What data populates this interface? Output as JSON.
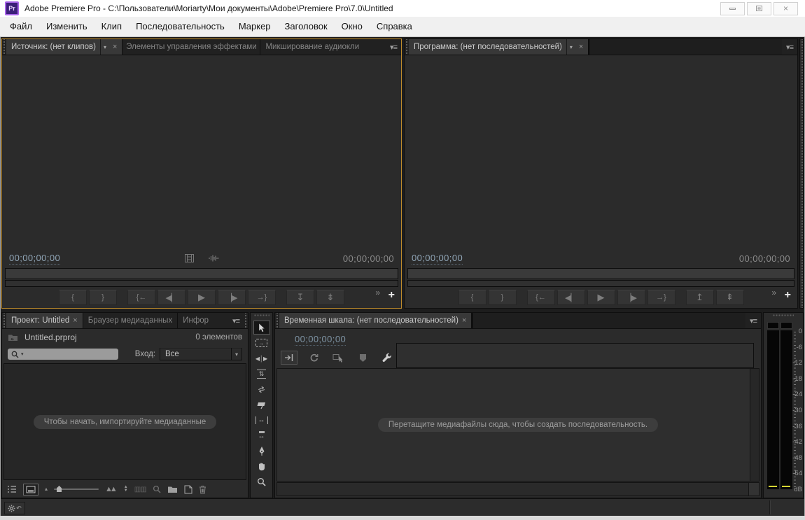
{
  "titlebar": {
    "app_icon_text": "Pr",
    "title": "Adobe Premiere Pro - C:\\Пользователи\\Moriarty\\Мои документы\\Adobe\\Premiere Pro\\7.0\\Untitled",
    "window_controls": {
      "close": "×"
    }
  },
  "menubar": {
    "items": [
      "Файл",
      "Изменить",
      "Клип",
      "Последовательность",
      "Маркер",
      "Заголовок",
      "Окно",
      "Справка"
    ]
  },
  "source_monitor": {
    "tab_source": "Источник: (нет клипов)",
    "tab_effects": "Элементы управления эффектами",
    "tab_audio_mixer": "Микширование аудиокли",
    "timecode_current": "00;00;00;00",
    "timecode_duration": "00;00;00;00"
  },
  "program_monitor": {
    "tab_program": "Программа: (нет последовательностей)",
    "timecode_current": "00;00;00;00",
    "timecode_duration": "00;00;00;00"
  },
  "transport": {
    "mark_in": "{",
    "mark_out": "}",
    "goto_in": "{←",
    "step_back": "◀▏",
    "play": "▶",
    "step_forward": "▕▶",
    "goto_out": "→}",
    "insert": "↧",
    "overwrite": "⇟",
    "lift": "↥",
    "extract": "⇞",
    "more": "»",
    "add_button": "+"
  },
  "project_panel": {
    "tab_project": "Проект: Untitled",
    "tab_media_browser": "Браузер медиаданных",
    "tab_info": "Инфор",
    "project_file": "Untitled.prproj",
    "item_count": "0 элементов",
    "filter_label": "Вход:",
    "filter_value": "Все",
    "empty_message": "Чтобы начать, импортируйте медиаданные"
  },
  "timeline_panel": {
    "tab_timeline": "Временная шкала: (нет последовательностей)",
    "timecode": "00;00;00;00",
    "empty_message": "Перетащите медиафайлы сюда, чтобы создать последовательность."
  },
  "audio_meter": {
    "scale": [
      "0",
      "-6",
      "-12",
      "-18",
      "-24",
      "-30",
      "-36",
      "-42",
      "-48",
      "-54",
      "dB"
    ]
  },
  "glyphs": {
    "panel_menu": "▾≡",
    "dropdown_arrow": "▾",
    "tab_close": "×",
    "tool_track_select": "→",
    "tool_ripple": "◀│▶",
    "tool_rolling": "⇅",
    "tool_rate_stretch": "⇄",
    "tool_slip": "↔",
    "tool_slide": "↔",
    "sort_up": "▲",
    "sort_down": "▼",
    "zoom_out_tri": "▴",
    "zoom_in_tri": "▲▲",
    "automate": "▥▥"
  },
  "colors": {
    "focus_border": "#bf8c2c",
    "timecode_blue": "#8fa4b5",
    "meter_yellow": "#d6d633",
    "panel_bg": "#2b2b2b",
    "app_bg": "#1d1d1d",
    "chrome_bg": "#f0f0f0"
  }
}
